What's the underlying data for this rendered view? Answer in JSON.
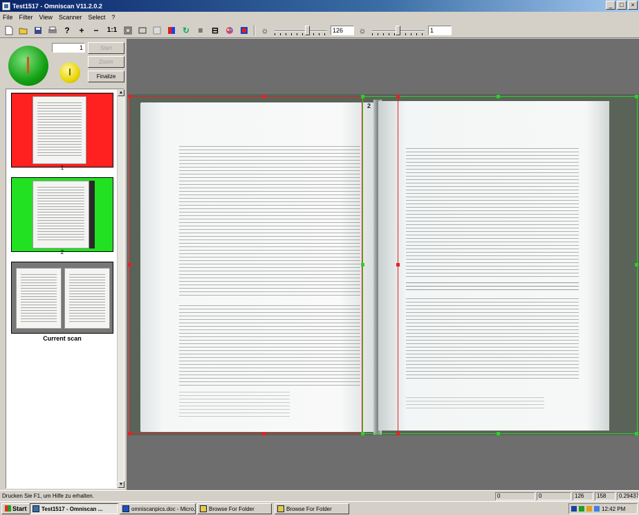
{
  "window": {
    "title": "Test1517 - Omniscan V11.2.0.2"
  },
  "menu": [
    "File",
    "Filter",
    "View",
    "Scanner",
    "Select",
    "?"
  ],
  "toolbar": {
    "zoom_label": "1:1",
    "threshold_value": "126",
    "brightness_value": "1"
  },
  "left_panel": {
    "counter_value": "1",
    "buttons": {
      "start": "Start",
      "zoom": "Zoom",
      "finalize": "Finalize"
    },
    "thumbnails": [
      {
        "label": "1",
        "status_color": "#ff2020"
      },
      {
        "label": "2",
        "status_color": "#22e022"
      }
    ],
    "current_scan_label": "Current scan"
  },
  "canvas": {
    "page_number": "2",
    "selection_colors": {
      "left": "#e82020",
      "right": "#2ad02a"
    }
  },
  "statusbar": {
    "message": "Drucken Sie F1, um Hilfe zu erhalten.",
    "fields": [
      "0",
      "0",
      "126",
      "158",
      "0.29437"
    ]
  },
  "taskbar": {
    "start": "Start",
    "tasks": [
      {
        "label": "Test1517 - Omniscan ...",
        "active": true
      },
      {
        "label": "omniscanpics.doc - Micro...",
        "active": false
      },
      {
        "label": "Browse For Folder",
        "active": false
      },
      {
        "label": "Browse For Folder",
        "active": false
      }
    ],
    "clock": "12:42 PM"
  }
}
